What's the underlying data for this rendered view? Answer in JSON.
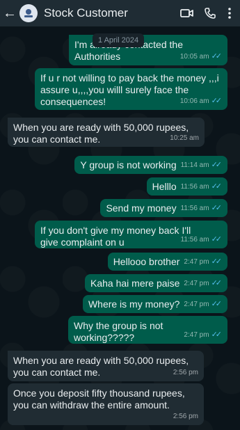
{
  "header": {
    "title": "Stock Customer",
    "back_icon": "arrow-left-icon",
    "video_icon": "video-call-icon",
    "call_icon": "phone-icon",
    "menu_icon": "more-vertical-icon"
  },
  "date_separator": "1 April 2024",
  "messages": [
    {
      "dir": "out",
      "text": "I'm already contacted the Authorities",
      "time": "10:05 am"
    },
    {
      "dir": "out",
      "text": "If u r not willing to pay back the money ,,,i assure u,,,,you willl surely face the consequences!",
      "time": "10:06 am"
    },
    {
      "dir": "in",
      "text": "When you are ready with 50,000 rupees, you can contact me.",
      "time": "10:25 am"
    },
    {
      "dir": "out",
      "text": "Y group is not working",
      "time": "11:14 am"
    },
    {
      "dir": "out",
      "text": "Helllo",
      "time": "11:56 am"
    },
    {
      "dir": "out",
      "text": "Send my money",
      "time": "11:56 am"
    },
    {
      "dir": "out",
      "text": "If you don't give my money back I'll give complaint on u",
      "time": "11:56 am"
    },
    {
      "dir": "out",
      "text": "Hellooo brother",
      "time": "2:47 pm"
    },
    {
      "dir": "out",
      "text": "Kaha hai mere paise",
      "time": "2:47 pm"
    },
    {
      "dir": "out",
      "text": "Where is my money?",
      "time": "2:47 pm"
    },
    {
      "dir": "out",
      "text": "Why the group is not working?????",
      "time": "2:47 pm"
    },
    {
      "dir": "in",
      "text": "When you are ready with 50,000 rupees, you can contact me.",
      "time": "2:56 pm"
    },
    {
      "dir": "in",
      "text": "Once you deposit fifty thousand rupees, you can withdraw the entire amount.",
      "time": "2:56 pm"
    }
  ],
  "colors": {
    "header_bg": "#1f2c34",
    "chat_bg": "#0b141a",
    "outgoing_bubble": "#005c4b",
    "incoming_bubble": "#202c33",
    "read_ticks": "#53bdeb"
  }
}
